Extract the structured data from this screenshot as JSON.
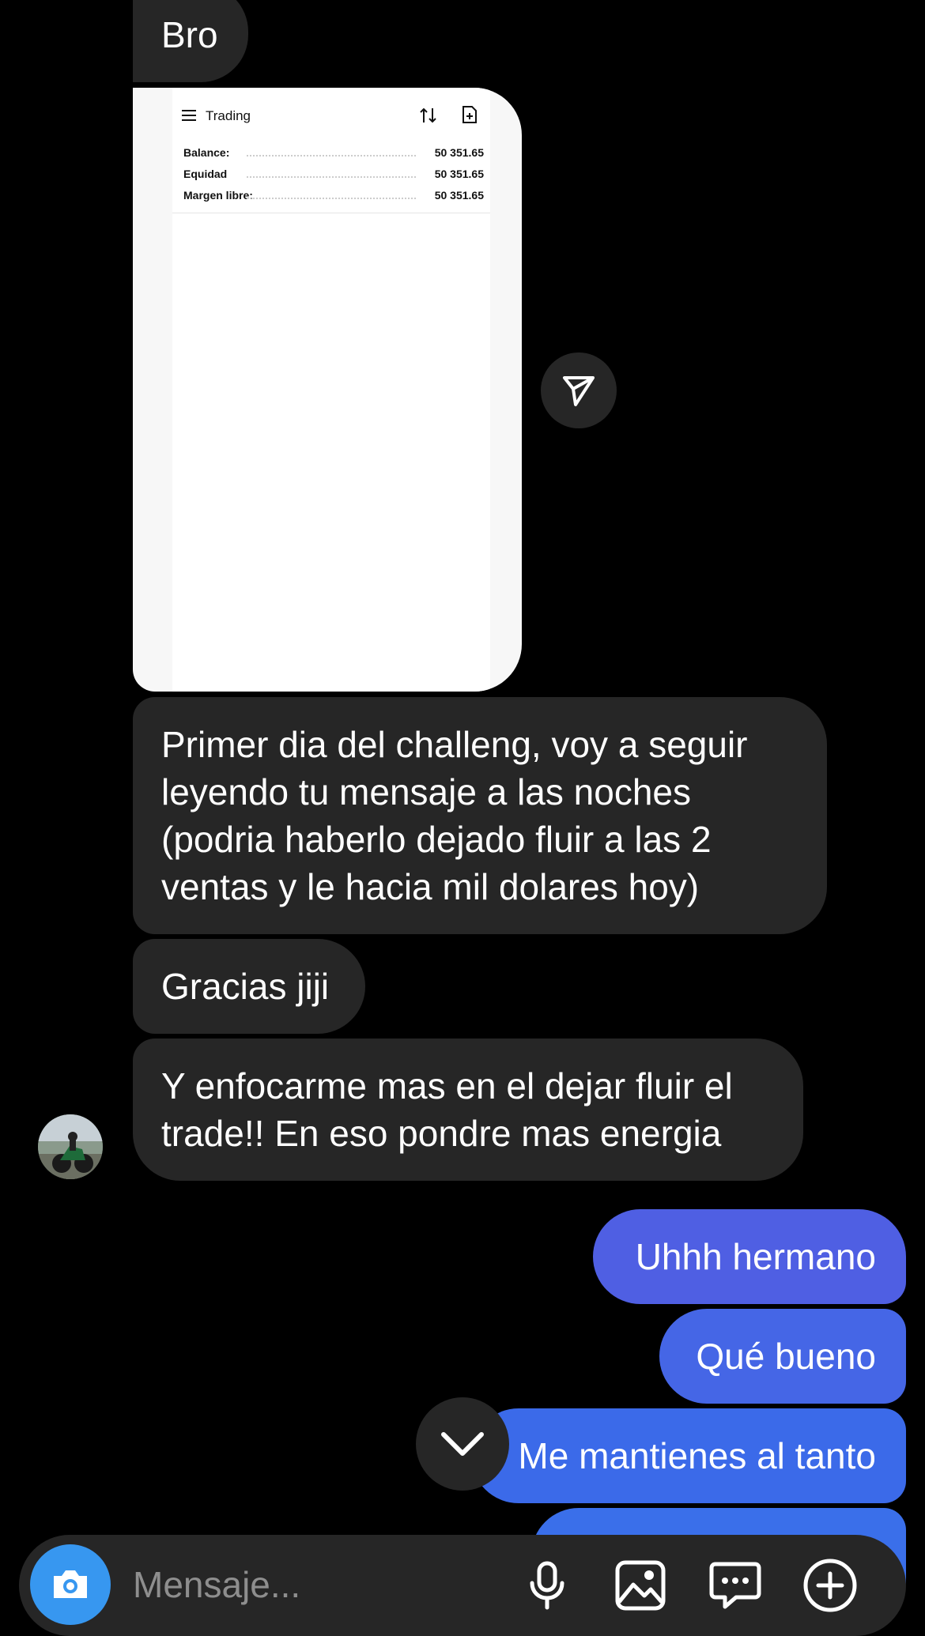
{
  "messages_in": [
    {
      "text": "Bro"
    },
    {
      "text": "Primer dia del challeng, voy a seguir\nleyendo tu mensaje a las noches\n(podria haberlo dejado fluir a las 2\nventas y le hacia mil dolares hoy)"
    },
    {
      "text": "Gracias jiji"
    },
    {
      "text": "Y enfocarme mas en el dejar fluir el\ntrade!! En eso pondre mas energia"
    }
  ],
  "shared_image": {
    "title": "Trading",
    "rows": [
      {
        "label": "Balance:",
        "value": "50 351.65"
      },
      {
        "label": "Equidad",
        "value": "50 351.65"
      },
      {
        "label": "Margen libre:",
        "value": "50 351.65"
      }
    ]
  },
  "messages_out": [
    {
      "text": "Uhhh hermano"
    },
    {
      "text": "Qué bueno"
    },
    {
      "text": "Me mantienes al tanto"
    }
  ],
  "composer": {
    "placeholder": "Mensaje..."
  },
  "colors": {
    "background": "#000000",
    "incoming_bubble": "#262626",
    "outgoing_bubble_start": "#3b5bdb",
    "camera_button": "#3797f0"
  },
  "icons": {
    "camera": "camera-icon",
    "microphone": "microphone-icon",
    "gallery": "image-icon",
    "sticker": "chat-bubble-icon",
    "add": "plus-circle-icon",
    "share": "paper-plane-icon",
    "scroll_down": "chevron-down-icon"
  }
}
